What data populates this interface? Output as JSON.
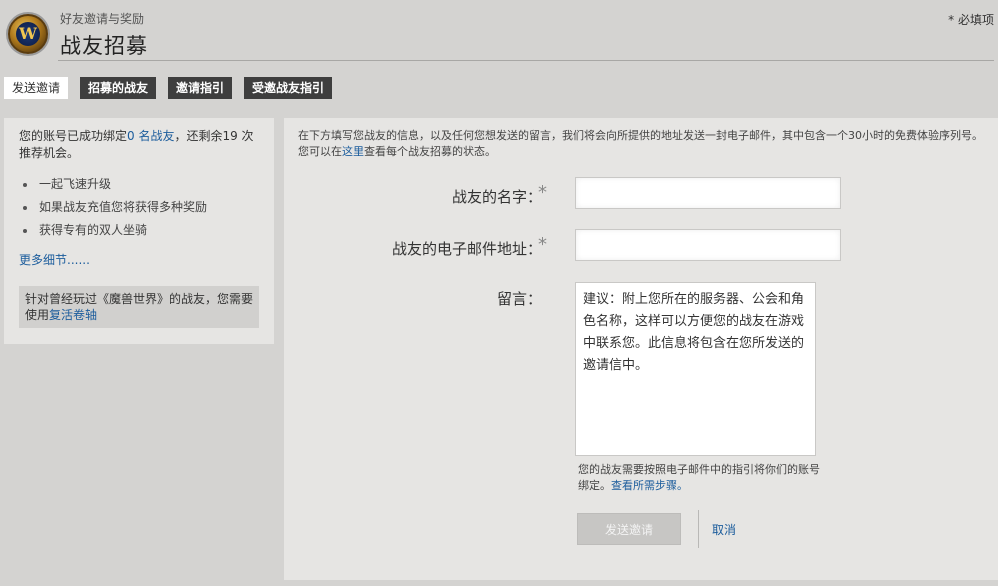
{
  "header": {
    "logo_letter": "W",
    "subtitle": "好友邀请与奖励",
    "title": "战友招募",
    "required_note": "* 必填项"
  },
  "tabs": [
    {
      "label": "发送邀请",
      "active": true
    },
    {
      "label": "招募的战友",
      "active": false
    },
    {
      "label": "邀请指引",
      "active": false
    },
    {
      "label": "受邀战友指引",
      "active": false
    }
  ],
  "sidebar": {
    "status_prefix": "您的账号已成功绑定",
    "status_link": "0 名战友",
    "status_suffix": "，还剩余19 次推荐机会。",
    "benefits": [
      "一起飞速升级",
      "如果战友充值您将获得多种奖励",
      "获得专有的双人坐骑"
    ],
    "more_link": "更多细节......",
    "note_prefix": "针对曾经玩过《魔兽世界》的战友，您需要使用",
    "note_link": "复活卷轴"
  },
  "form": {
    "intro_prefix": "在下方填写您战友的信息，以及任何您想发送的留言，我们将会向所提供的地址发送一封电子邮件，其中包含一个30小时的免费体验序列号。您可以在",
    "intro_link": "这里",
    "intro_suffix": "查看每个战友招募的状态。",
    "name_label": "战友的名字：",
    "name_value": "",
    "email_label": "战友的电子邮件地址：",
    "email_value": "",
    "asterisk": "*",
    "message_label": "留言：",
    "message_value": "建议：附上您所在的服务器、公会和角色名称，这样可以方便您的战友在游戏中联系您。此信息将包含在您所发送的邀请信中。",
    "hint_text": "您的战友需要按照电子邮件中的指引将你们的账号绑定。",
    "hint_link": "查看所需步骤。",
    "send_label": "发送邀请",
    "cancel_label": "取消"
  },
  "colors": {
    "background": "#d4d3d1",
    "panel": "#e6e5e3",
    "link": "#1b5c9c",
    "tab_dark": "#3e3e3e"
  }
}
